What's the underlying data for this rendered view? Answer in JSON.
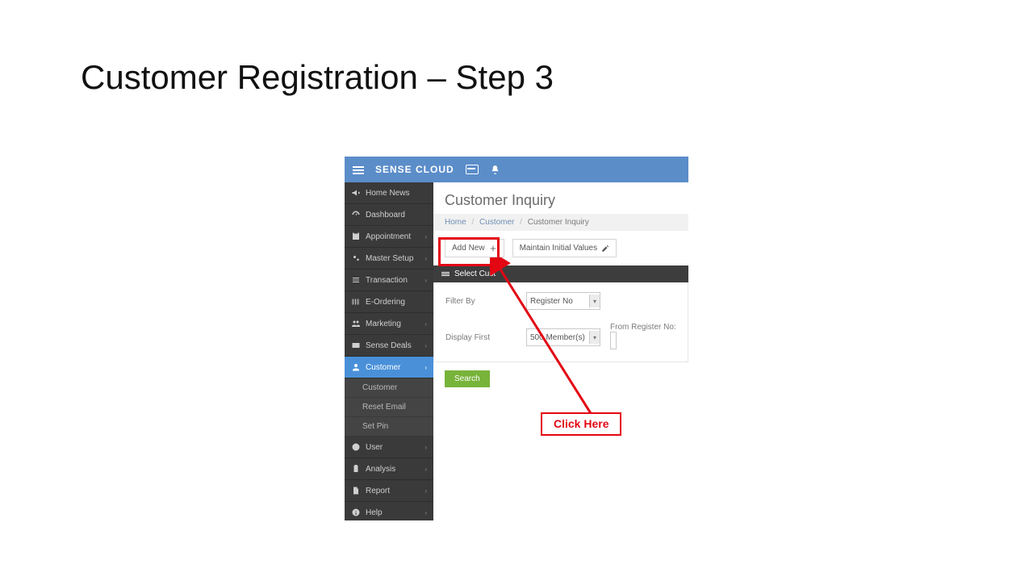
{
  "slide": {
    "title": "Customer Registration – Step 3"
  },
  "topbar": {
    "brand": "SENSE CLOUD"
  },
  "sidebar": {
    "items": [
      {
        "label": "Home News",
        "expandable": false
      },
      {
        "label": "Dashboard",
        "expandable": false
      },
      {
        "label": "Appointment",
        "expandable": true
      },
      {
        "label": "Master Setup",
        "expandable": true
      },
      {
        "label": "Transaction",
        "expandable": true
      },
      {
        "label": "E-Ordering",
        "expandable": false
      },
      {
        "label": "Marketing",
        "expandable": true
      },
      {
        "label": "Sense Deals",
        "expandable": true
      },
      {
        "label": "Customer",
        "expandable": true,
        "active": true
      },
      {
        "label": "User",
        "expandable": true
      },
      {
        "label": "Analysis",
        "expandable": true
      },
      {
        "label": "Report",
        "expandable": true
      },
      {
        "label": "Help",
        "expandable": true
      }
    ],
    "customer_sub": [
      {
        "label": "Customer"
      },
      {
        "label": "Reset Email"
      },
      {
        "label": "Set Pin"
      }
    ]
  },
  "page": {
    "title": "Customer Inquiry",
    "breadcrumb": {
      "a": "Home",
      "b": "Customer",
      "c": "Customer Inquiry"
    },
    "buttons": {
      "add_new": "Add New",
      "maintain": "Maintain Initial Values"
    },
    "panel_header": "Select Cust",
    "filters": {
      "filter_by_label": "Filter By",
      "filter_by_value": "Register No",
      "display_first_label": "Display First",
      "display_first_value": "500 Member(s)",
      "from_register_label": "From Register No:"
    },
    "search_label": "Search"
  },
  "annotation": {
    "callout": "Click Here"
  }
}
